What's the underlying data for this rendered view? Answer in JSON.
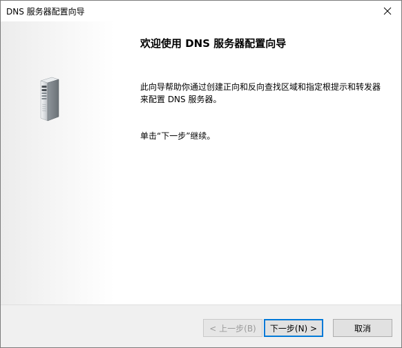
{
  "window": {
    "title": "DNS 服务器配置向导"
  },
  "icons": {
    "close": "close-icon",
    "server": "server-tower-icon"
  },
  "content": {
    "heading": "欢迎使用 DNS 服务器配置向导",
    "description": "此向导帮助你通过创建正向和反向查找区域和指定根提示和转发器来配置 DNS 服务器。",
    "hint": "单击“下一步”继续。"
  },
  "buttons": {
    "back": "< 上一步(B)",
    "next": "下一步(N) >",
    "cancel": "取消"
  },
  "colors": {
    "accent": "#0078d7",
    "footer_bg": "#f0f0f0",
    "button_bg": "#e1e1e1"
  }
}
